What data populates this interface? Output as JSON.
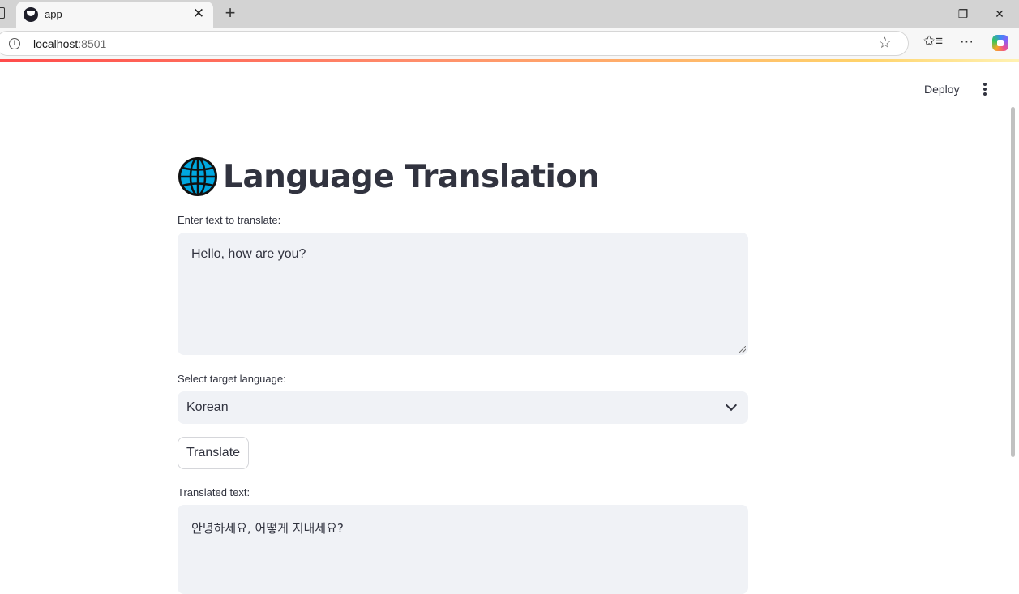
{
  "browser": {
    "tab_title": "app",
    "tab_close": "✕",
    "new_tab": "+",
    "url_host": "localhost",
    "url_port": ":8501",
    "window_controls": {
      "minimize": "—",
      "restore": "❐",
      "close": "✕"
    },
    "icons": [
      "info-icon",
      "star-icon",
      "favorites-icon",
      "more-icon",
      "copilot-icon"
    ]
  },
  "header": {
    "deploy_label": "Deploy"
  },
  "main": {
    "title": "Language Translation",
    "title_icon": "globe-icon",
    "input": {
      "label": "Enter text to translate:",
      "value": "Hello, how are you?"
    },
    "select": {
      "label": "Select target language:",
      "value": "Korean"
    },
    "button_label": "Translate",
    "output": {
      "label": "Translated text:",
      "value": "안녕하세요, 어떻게 지내세요?"
    }
  },
  "colors": {
    "input_bg": "#f0f2f6",
    "text": "#31333f",
    "accent_gradient_start": "#ff4b4b",
    "accent_gradient_end": "#ffd36b"
  }
}
